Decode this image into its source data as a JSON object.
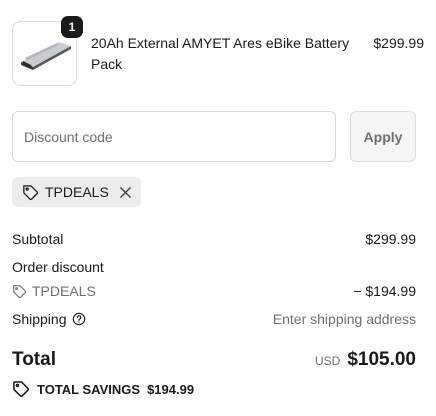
{
  "line_item": {
    "quantity": "1",
    "name": "20Ah External AMYET Ares eBike Battery Pack",
    "price": "$299.99"
  },
  "discount": {
    "placeholder": "Discount code",
    "value": "",
    "apply_label": "Apply",
    "applied_code": "TPDEALS"
  },
  "summary": {
    "subtotal_label": "Subtotal",
    "subtotal_value": "$299.99",
    "order_discount_label": "Order discount",
    "discount_code": "TPDEALS",
    "discount_value": "− $194.99",
    "shipping_label": "Shipping",
    "shipping_value": "Enter shipping address",
    "total_label": "Total",
    "currency": "USD",
    "total_value": "$105.00",
    "savings_label": "TOTAL SAVINGS",
    "savings_value": "$194.99"
  },
  "icons": {
    "tag": "tag-icon",
    "close": "close-icon",
    "info": "info-icon",
    "product_image": "battery-pack-image"
  }
}
